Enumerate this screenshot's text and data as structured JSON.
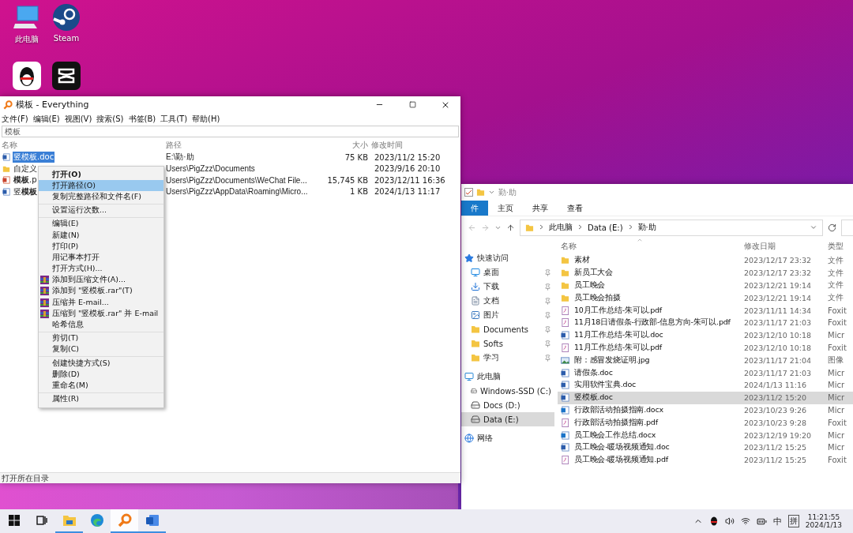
{
  "desktop_icons": [
    {
      "kind": "computer",
      "label": "此电脑"
    },
    {
      "kind": "steam",
      "label": "Steam"
    },
    {
      "kind": "qq"
    },
    {
      "kind": "capcut"
    }
  ],
  "everything": {
    "title": "模板 - Everything",
    "menu": [
      "文件(F)",
      "编辑(E)",
      "视图(V)",
      "搜索(S)",
      "书签(B)",
      "工具(T)",
      "帮助(H)"
    ],
    "search": {
      "value": "模板"
    },
    "columns": [
      "名称",
      "路径",
      "大小",
      "修改时间"
    ],
    "rows": [
      {
        "kind": "doc",
        "name": "竖模板.doc",
        "path": "E:\\勤·助",
        "size": "75 KB",
        "modified": "2023/11/2 15:20",
        "selected": true
      },
      {
        "kind": "folder",
        "name": "自定义",
        "path": "Users\\PigZzz\\Documents",
        "modified": "2023/9/16 20:10",
        "selected": false
      },
      {
        "kind": "ppt",
        "name": "**模板**.p",
        "path": "Users\\PigZzz\\Documents\\WeChat File...",
        "size": "15,745 KB",
        "modified": "2023/12/11 16:36",
        "selected": false
      },
      {
        "kind": "doc",
        "name": "竖**模板**",
        "path": "Users\\PigZzz\\AppData\\Roaming\\Micro...",
        "size": "1 KB",
        "modified": "2024/1/13 11:17",
        "selected": false
      }
    ],
    "status": "打开所在目录"
  },
  "context_menu": {
    "groups": [
      {
        "items": [
          {
            "label": "打开(O)",
            "default": true,
            "selected": false,
            "archive_icon": false
          },
          {
            "label": "打开路径(O)",
            "default": false,
            "selected": true,
            "archive_icon": false
          },
          {
            "label": "复制完整路径和文件名(F)",
            "default": false,
            "selected": false,
            "archive_icon": false
          }
        ]
      },
      {
        "items": [
          {
            "label": "设置运行次数...",
            "default": false,
            "selected": false,
            "archive_icon": false
          }
        ]
      },
      {
        "items": [
          {
            "label": "编辑(E)",
            "default": false,
            "selected": false,
            "archive_icon": false
          },
          {
            "label": "新建(N)",
            "default": false,
            "selected": false,
            "archive_icon": false
          },
          {
            "label": "打印(P)",
            "default": false,
            "selected": false,
            "archive_icon": false
          },
          {
            "label": "用记事本打开",
            "default": false,
            "selected": false,
            "archive_icon": false
          },
          {
            "label": "打开方式(H)...",
            "default": false,
            "selected": false,
            "archive_icon": false
          },
          {
            "label": "添加到压缩文件(A)...",
            "default": false,
            "selected": false,
            "archive_icon": true
          },
          {
            "label": "添加到 \"竖模板.rar\"(T)",
            "default": false,
            "selected": false,
            "archive_icon": true
          },
          {
            "label": "压缩并 E-mail...",
            "default": false,
            "selected": false,
            "archive_icon": true
          },
          {
            "label": "压缩到 \"竖模板.rar\" 并 E-mail",
            "default": false,
            "selected": false,
            "archive_icon": true
          },
          {
            "label": "哈希信息",
            "default": false,
            "selected": false,
            "archive_icon": false
          }
        ]
      },
      {
        "items": [
          {
            "label": "剪切(T)",
            "default": false,
            "selected": false,
            "archive_icon": false
          },
          {
            "label": "复制(C)",
            "default": false,
            "selected": false,
            "archive_icon": false
          }
        ]
      },
      {
        "items": [
          {
            "label": "创建快捷方式(S)",
            "default": false,
            "selected": false,
            "archive_icon": false
          },
          {
            "label": "删除(D)",
            "default": false,
            "selected": false,
            "archive_icon": false
          },
          {
            "label": "重命名(M)",
            "default": false,
            "selected": false,
            "archive_icon": false
          }
        ]
      },
      {
        "items": [
          {
            "label": "属性(R)",
            "default": false,
            "selected": false,
            "archive_icon": false
          }
        ]
      }
    ]
  },
  "explorer": {
    "title": "勤·助",
    "tabs": [
      {
        "label": "件",
        "selected": true
      },
      {
        "label": "主页",
        "selected": false
      },
      {
        "label": "共享",
        "selected": false
      },
      {
        "label": "查看",
        "selected": false
      }
    ],
    "breadcrumb": [
      "此电脑",
      "Data (E:)",
      "勤·助"
    ],
    "columns": [
      "名称",
      "修改日期",
      "类型"
    ],
    "nav": [
      {
        "kind": "star",
        "label": "快速访问",
        "selected": false,
        "children": [
          {
            "kind": "desktop",
            "label": "桌面",
            "pinned": true,
            "selected": false
          },
          {
            "kind": "download",
            "label": "下载",
            "pinned": true,
            "selected": false
          },
          {
            "kind": "document",
            "label": "文档",
            "pinned": true,
            "selected": false
          },
          {
            "kind": "pictures",
            "label": "图片",
            "pinned": true,
            "selected": false
          },
          {
            "kind": "folder",
            "label": "Documents",
            "pinned": true,
            "selected": false
          },
          {
            "kind": "folder",
            "label": "Softs",
            "pinned": true,
            "selected": false
          },
          {
            "kind": "folder",
            "label": "学习",
            "pinned": true,
            "selected": false
          }
        ]
      },
      {
        "kind": "computer",
        "label": "此电脑",
        "selected": false,
        "children": [
          {
            "kind": "drive",
            "label": "Windows-SSD (C:)",
            "pinned": false,
            "selected": false
          },
          {
            "kind": "drive",
            "label": "Docs (D:)",
            "pinned": false,
            "selected": false
          },
          {
            "kind": "drive",
            "label": "Data (E:)",
            "pinned": false,
            "selected": true
          }
        ]
      },
      {
        "kind": "network",
        "label": "网络",
        "selected": false
      }
    ],
    "files": [
      {
        "kind": "folder",
        "name": "素材",
        "modified": "2023/12/17 23:32",
        "type": "文件",
        "selected": false
      },
      {
        "kind": "folder",
        "name": "新员工大会",
        "modified": "2023/12/17 23:32",
        "type": "文件",
        "selected": false
      },
      {
        "kind": "folder",
        "name": "员工晚会",
        "modified": "2023/12/21 19:14",
        "type": "文件",
        "selected": false
      },
      {
        "kind": "folder",
        "name": "员工晚会拍摄",
        "modified": "2023/12/21 19:14",
        "type": "文件",
        "selected": false
      },
      {
        "kind": "pdf",
        "name": "10月工作总结-朱可以.pdf",
        "modified": "2023/11/11 14:34",
        "type": "Foxit",
        "selected": false
      },
      {
        "kind": "pdf",
        "name": "11月18日请假条-行政部-信息方向-朱可以.pdf",
        "modified": "2023/11/17 21:03",
        "type": "Foxit",
        "selected": false
      },
      {
        "kind": "doc",
        "name": "11月工作总结-朱可以.doc",
        "modified": "2023/12/10 10:18",
        "type": "Micr",
        "selected": false
      },
      {
        "kind": "pdf",
        "name": "11月工作总结-朱可以.pdf",
        "modified": "2023/12/10 10:18",
        "type": "Foxit",
        "selected": false
      },
      {
        "kind": "image",
        "name": "附：感冒发烧证明.jpg",
        "modified": "2023/11/17 21:04",
        "type": "图像",
        "selected": false
      },
      {
        "kind": "doc",
        "name": "请假条.doc",
        "modified": "2023/11/17 21:03",
        "type": "Micr",
        "selected": false
      },
      {
        "kind": "doc",
        "name": "实用软件宝典.doc",
        "modified": "2024/1/13 11:16",
        "type": "Micr",
        "selected": false
      },
      {
        "kind": "doc",
        "name": "竖模板.doc",
        "modified": "2023/11/2 15:20",
        "type": "Micr",
        "selected": true
      },
      {
        "kind": "docx",
        "name": "行政部活动拍摄指南.docx",
        "modified": "2023/10/23 9:26",
        "type": "Micr",
        "selected": false
      },
      {
        "kind": "pdf",
        "name": "行政部活动拍摄指南.pdf",
        "modified": "2023/10/23 9:28",
        "type": "Foxit",
        "selected": false
      },
      {
        "kind": "docx",
        "name": "员工晚会工作总结.docx",
        "modified": "2023/12/19 19:20",
        "type": "Micr",
        "selected": false
      },
      {
        "kind": "doc",
        "name": "员工晚会-暖场视频通知.doc",
        "modified": "2023/11/2 15:25",
        "type": "Micr",
        "selected": false
      },
      {
        "kind": "pdf",
        "name": "员工晚会-暖场视频通知.pdf",
        "modified": "2023/11/2 15:25",
        "type": "Foxit",
        "selected": false
      }
    ]
  },
  "taskbar": {
    "apps": [
      {
        "kind": "start",
        "running": false,
        "selected": false
      },
      {
        "kind": "taskview",
        "running": false,
        "selected": false
      },
      {
        "kind": "explorer",
        "running": true,
        "selected": false
      },
      {
        "kind": "edge",
        "running": false,
        "selected": false
      },
      {
        "kind": "everything",
        "running": true,
        "selected": true
      },
      {
        "kind": "word",
        "running": true,
        "selected": false
      }
    ],
    "ime": [
      "中",
      "拼"
    ],
    "time": "11:21:55",
    "date": "2024/1/13"
  }
}
